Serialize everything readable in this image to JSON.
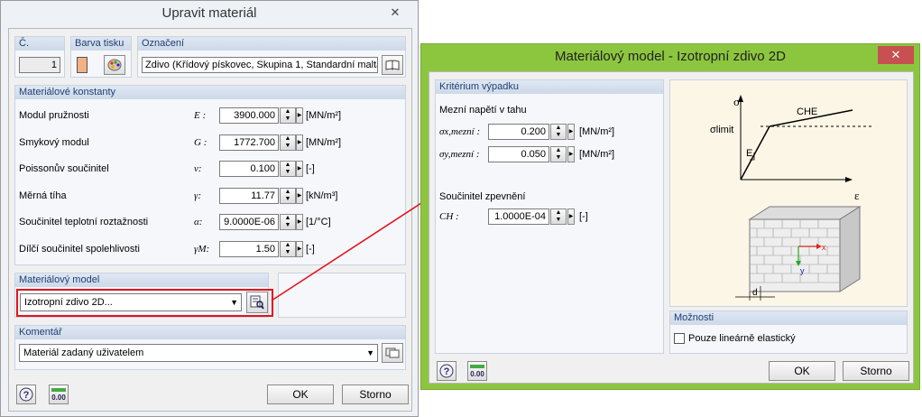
{
  "left_dialog": {
    "title": "Upravit materiál",
    "close_label": "✕",
    "number_label": "Č.",
    "number_value": "1",
    "color_label": "Barva tisku",
    "designation_label": "Označení",
    "designation_value": "Zdivo (Křídový pískovec, Skupina 1, Standardní malta",
    "constants_label": "Materiálové konstanty",
    "constants": [
      {
        "label": "Modul pružnosti",
        "symbol": "E :",
        "value": "3900.000",
        "unit": "[MN/m²]"
      },
      {
        "label": "Smykový modul",
        "symbol": "G :",
        "value": "1772.700",
        "unit": "[MN/m²]"
      },
      {
        "label": "Poissonův součinitel",
        "symbol": "ν:",
        "value": "0.100",
        "unit": "[-]"
      },
      {
        "label": "Měrná tíha",
        "symbol": "γ:",
        "value": "11.77",
        "unit": "[kN/m³]"
      },
      {
        "label": "Součinitel teplotní roztažnosti",
        "symbol": "α:",
        "value": "9.0000E-06",
        "unit": "[1/°C]"
      },
      {
        "label": "Dílčí součinitel spolehlivosti",
        "symbol": "γM:",
        "value": "1.50",
        "unit": "[-]"
      }
    ],
    "model_label": "Materiálový model",
    "model_value": "Izotropní zdivo 2D...",
    "comment_label": "Komentář",
    "comment_value": "Materiál zadaný uživatelem",
    "ok_label": "OK",
    "cancel_label": "Storno"
  },
  "right_dialog": {
    "title": "Materiálový model - Izotropní zdivo 2D",
    "close_label": "✕",
    "criterion_label": "Kritérium výpadku",
    "tensile_label": "Mezní napětí v tahu",
    "sx_symbol": "σx,mezní :",
    "sx_value": "0.200",
    "sx_unit": "[MN/m²]",
    "sy_symbol": "σy,mezní :",
    "sy_value": "0.050",
    "sy_unit": "[MN/m²]",
    "hardening_label": "Součinitel zpevnění",
    "ch_symbol": "CH :",
    "ch_value": "1.0000E-04",
    "ch_unit": "[-]",
    "options_label": "Možnosti",
    "elastic_only_label": "Pouze lineárně elastický",
    "elastic_only_checked": false,
    "ok_label": "OK",
    "cancel_label": "Storno",
    "diagram": {
      "sigma": "σ",
      "sigma_limit": "σlimit",
      "che": "CHE",
      "e": "E",
      "epsilon": "ε",
      "d": "d",
      "x": "x",
      "y": "y"
    }
  },
  "colors": {
    "right_titlebar": "#8cc63f",
    "arrow": "#e0141e",
    "highlight_box": "#e0141e",
    "print_color_swatch": "#f4b183"
  },
  "icons": {
    "help": "help-icon",
    "units": "units-icon",
    "library": "book-icon",
    "palette": "palette-icon",
    "edit": "edit-icon",
    "comment_library": "comment-library-icon"
  }
}
